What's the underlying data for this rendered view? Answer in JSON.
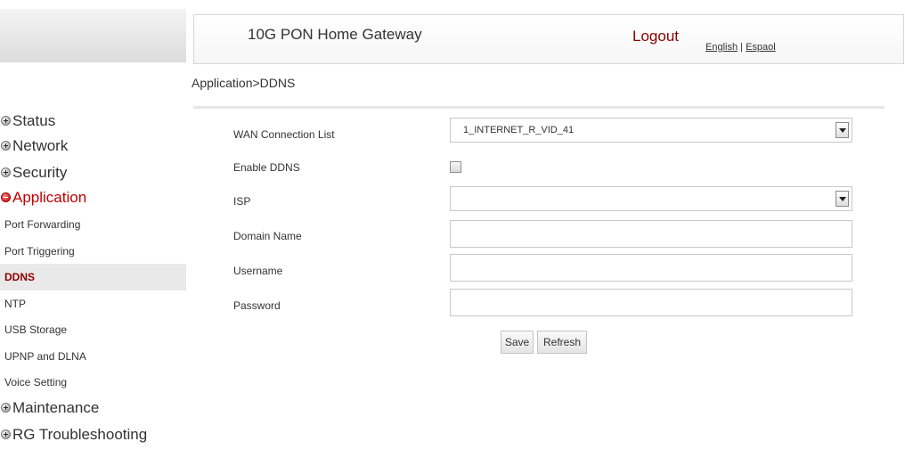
{
  "header": {
    "title": "10G PON Home Gateway",
    "logout": "Logout",
    "lang_english": "English",
    "lang_sep": " | ",
    "lang_espanol": "Espaol"
  },
  "breadcrumb": "Application>DDNS",
  "sidebar": {
    "status": "Status",
    "network": "Network",
    "security": "Security",
    "application": "Application",
    "sub": {
      "port_forwarding": "Port Forwarding",
      "port_triggering": "Port Triggering",
      "ddns": "DDNS",
      "ntp": "NTP",
      "usb_storage": "USB Storage",
      "upnp_dlna": "UPNP and DLNA",
      "voice_setting": "Voice Setting"
    },
    "maintenance": "Maintenance",
    "rg_troubleshooting": "RG Troubleshooting"
  },
  "form": {
    "wan_label": "WAN Connection List",
    "wan_value": "1_INTERNET_R_VID_41",
    "enable_label": "Enable DDNS",
    "enable_checked": false,
    "isp_label": "ISP",
    "isp_value": "",
    "domain_label": "Domain Name",
    "domain_value": "",
    "username_label": "Username",
    "username_value": "",
    "password_label": "Password",
    "password_value": ""
  },
  "buttons": {
    "save": "Save",
    "refresh": "Refresh"
  }
}
